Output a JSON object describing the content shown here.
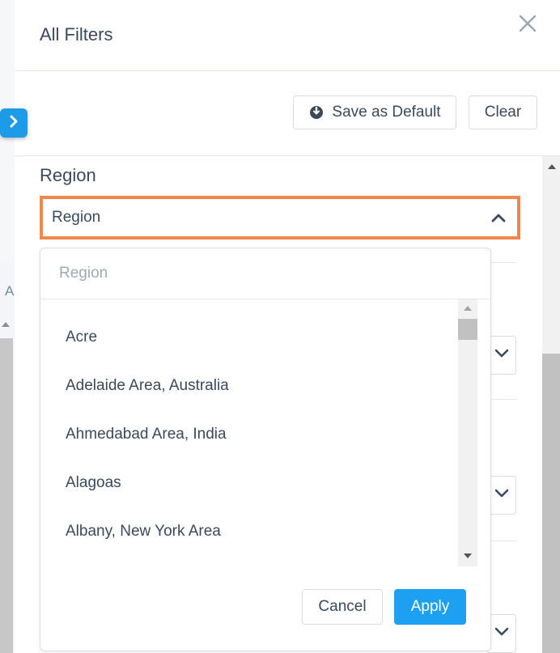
{
  "panel": {
    "title": "All Filters",
    "save_default_label": "Save as Default",
    "clear_label": "Clear"
  },
  "background": {
    "partial_letter": "A"
  },
  "region": {
    "section_title": "Region",
    "select_value": "Region",
    "search_placeholder": "Region",
    "items": [
      "Acre",
      "Adelaide Area, Australia",
      "Ahmedabad Area, India",
      "Alagoas",
      "Albany, New York Area"
    ],
    "cancel_label": "Cancel",
    "apply_label": "Apply"
  },
  "colors": {
    "accent": "#1ea0f2",
    "focus_border": "#f0884e",
    "text": "#3a4a5c"
  },
  "icons": [
    "chevron-right-icon",
    "close-icon",
    "save-default-icon",
    "chevron-up-icon",
    "chevron-down-icon"
  ]
}
